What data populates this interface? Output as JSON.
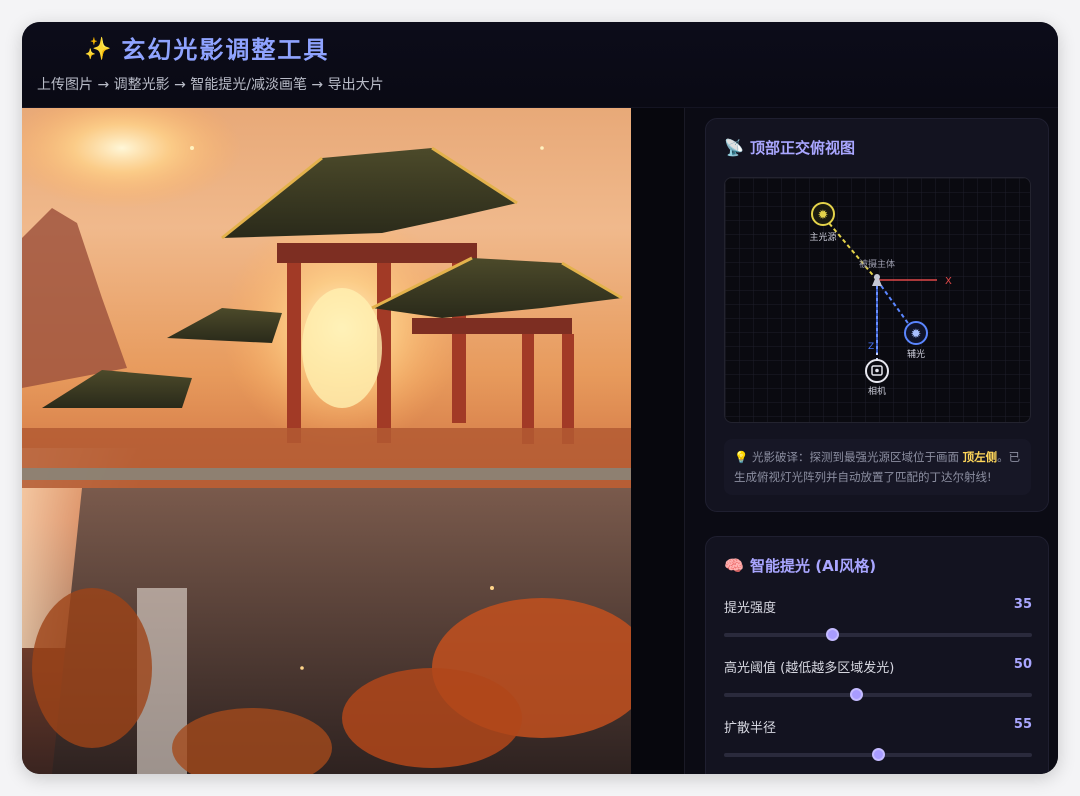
{
  "header": {
    "title": "玄幻光影调整工具",
    "subtitle": "上传图片 → 调整光影 → 智能提光/减淡画笔 → 导出大片"
  },
  "topview": {
    "title": "顶部正交俯视图",
    "labels": {
      "main_light": "主光源",
      "subject": "被摄主体",
      "fill_light": "辅光",
      "camera": "相机",
      "x_axis": "X",
      "z_axis": "Z"
    },
    "hint_prefix": "光影破译：探测到最强光源区域位于画面",
    "hint_strong": "顶左侧",
    "hint_suffix": "。已生成俯视灯光阵列并自动放置了匹配的丁达尔射线!"
  },
  "smart_light": {
    "title": "智能提光 (AI风格)",
    "sliders": [
      {
        "label": "提光强度",
        "value": "35",
        "fraction": 0.35
      },
      {
        "label": "高光阈值 (越低越多区域发光)",
        "value": "50",
        "fraction": 0.43
      },
      {
        "label": "扩散半径",
        "value": "55",
        "fraction": 0.5
      }
    ]
  },
  "colors": {
    "accent": "#a9a6ff",
    "title_blue": "#8fa3ff",
    "highlight_yellow": "#ffd75a"
  }
}
